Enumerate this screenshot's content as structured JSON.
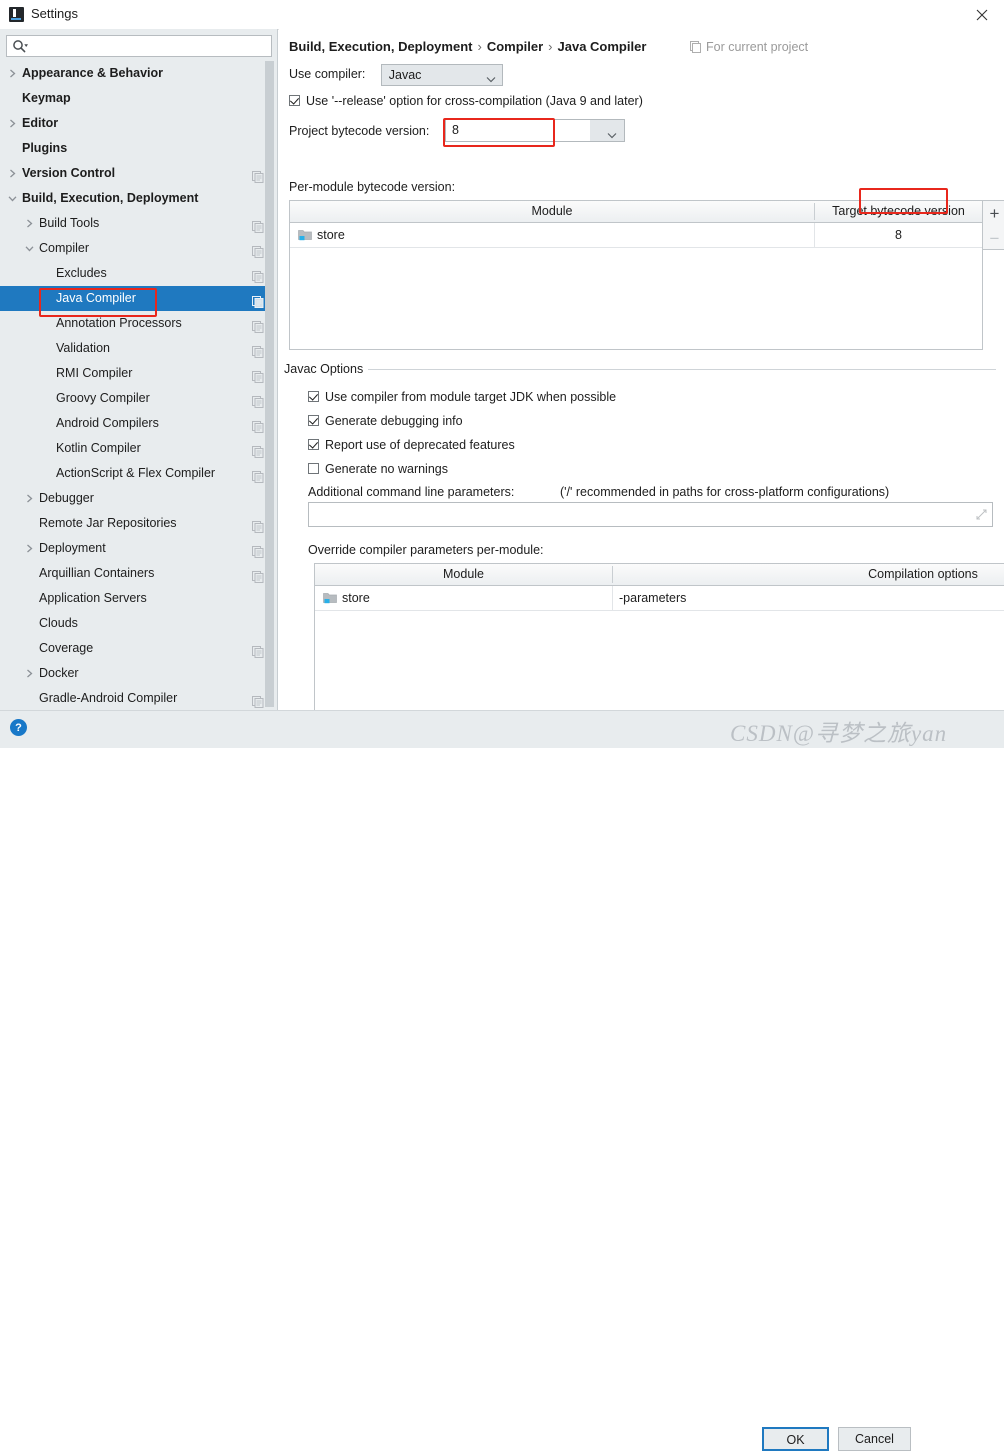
{
  "window": {
    "title": "Settings",
    "app_icon": "intellij-idea-icon",
    "close_label": "✕"
  },
  "sidebar": {
    "search": {
      "placeholder": "",
      "value": "",
      "icon": "search-icon"
    },
    "items": [
      {
        "label": "Appearance & Behavior",
        "indent": 0,
        "arrow": "right",
        "bold": true,
        "gear": false,
        "selected": false
      },
      {
        "label": "Keymap",
        "indent": 0,
        "arrow": "none",
        "bold": true,
        "gear": false,
        "selected": false
      },
      {
        "label": "Editor",
        "indent": 0,
        "arrow": "right",
        "bold": true,
        "gear": false,
        "selected": false
      },
      {
        "label": "Plugins",
        "indent": 0,
        "arrow": "none",
        "bold": true,
        "gear": false,
        "selected": false
      },
      {
        "label": "Version Control",
        "indent": 0,
        "arrow": "right",
        "bold": true,
        "gear": true,
        "selected": false
      },
      {
        "label": "Build, Execution, Deployment",
        "indent": 0,
        "arrow": "down",
        "bold": true,
        "gear": false,
        "selected": false
      },
      {
        "label": "Build Tools",
        "indent": 1,
        "arrow": "right",
        "bold": false,
        "gear": true,
        "selected": false
      },
      {
        "label": "Compiler",
        "indent": 1,
        "arrow": "down",
        "bold": false,
        "gear": true,
        "selected": false
      },
      {
        "label": "Excludes",
        "indent": 2,
        "arrow": "none",
        "bold": false,
        "gear": true,
        "selected": false
      },
      {
        "label": "Java Compiler",
        "indent": 2,
        "arrow": "none",
        "bold": false,
        "gear": true,
        "selected": true
      },
      {
        "label": "Annotation Processors",
        "indent": 2,
        "arrow": "none",
        "bold": false,
        "gear": true,
        "selected": false
      },
      {
        "label": "Validation",
        "indent": 2,
        "arrow": "none",
        "bold": false,
        "gear": true,
        "selected": false
      },
      {
        "label": "RMI Compiler",
        "indent": 2,
        "arrow": "none",
        "bold": false,
        "gear": true,
        "selected": false
      },
      {
        "label": "Groovy Compiler",
        "indent": 2,
        "arrow": "none",
        "bold": false,
        "gear": true,
        "selected": false
      },
      {
        "label": "Android Compilers",
        "indent": 2,
        "arrow": "none",
        "bold": false,
        "gear": true,
        "selected": false
      },
      {
        "label": "Kotlin Compiler",
        "indent": 2,
        "arrow": "none",
        "bold": false,
        "gear": true,
        "selected": false
      },
      {
        "label": "ActionScript & Flex Compiler",
        "indent": 2,
        "arrow": "none",
        "bold": false,
        "gear": true,
        "selected": false
      },
      {
        "label": "Debugger",
        "indent": 1,
        "arrow": "right",
        "bold": false,
        "gear": false,
        "selected": false
      },
      {
        "label": "Remote Jar Repositories",
        "indent": 1,
        "arrow": "none",
        "bold": false,
        "gear": true,
        "selected": false
      },
      {
        "label": "Deployment",
        "indent": 1,
        "arrow": "right",
        "bold": false,
        "gear": true,
        "selected": false
      },
      {
        "label": "Arquillian Containers",
        "indent": 1,
        "arrow": "none",
        "bold": false,
        "gear": true,
        "selected": false
      },
      {
        "label": "Application Servers",
        "indent": 1,
        "arrow": "none",
        "bold": false,
        "gear": false,
        "selected": false
      },
      {
        "label": "Clouds",
        "indent": 1,
        "arrow": "none",
        "bold": false,
        "gear": false,
        "selected": false
      },
      {
        "label": "Coverage",
        "indent": 1,
        "arrow": "none",
        "bold": false,
        "gear": true,
        "selected": false
      },
      {
        "label": "Docker",
        "indent": 1,
        "arrow": "right",
        "bold": false,
        "gear": false,
        "selected": false
      },
      {
        "label": "Gradle-Android Compiler",
        "indent": 1,
        "arrow": "none",
        "bold": false,
        "gear": true,
        "selected": false
      }
    ]
  },
  "main": {
    "breadcrumb": {
      "part1": "Build, Execution, Deployment",
      "sep1": "›",
      "part2": "Compiler",
      "sep2": "›",
      "part3": "Java Compiler"
    },
    "for_current_project": "For current project",
    "use_compiler_label": "Use compiler:",
    "use_compiler_value": "Javac",
    "release_option_label": "Use '--release' option for cross-compilation (Java 9 and later)",
    "release_option_checked": true,
    "project_bytecode_label": "Project bytecode version:",
    "project_bytecode_value": "8",
    "per_module_label": "Per-module bytecode version:",
    "per_module_table": {
      "headers": [
        "Module",
        "Target bytecode version"
      ],
      "rows": [
        {
          "module": "store",
          "target": "8"
        }
      ],
      "add_label": "+",
      "remove_label": "−"
    },
    "javac_group_title": "Javac Options",
    "javac_options": [
      {
        "label": "Use compiler from module target JDK when possible",
        "checked": true
      },
      {
        "label": "Generate debugging info",
        "checked": true
      },
      {
        "label": "Report use of deprecated features",
        "checked": true
      },
      {
        "label": "Generate no warnings",
        "checked": false
      }
    ],
    "additional_params_label": "Additional command line parameters:",
    "additional_params_hint": "('/' recommended in paths for cross-platform configurations)",
    "additional_params_value": "",
    "override_label": "Override compiler parameters per-module:",
    "override_table": {
      "headers": [
        "Module",
        "Compilation options"
      ],
      "rows": [
        {
          "module": "store",
          "options": "-parameters"
        }
      ],
      "add_label": "+",
      "remove_label": "−"
    }
  },
  "footer": {
    "help_label": "?",
    "ok_label": "OK",
    "cancel_label": "Cancel"
  },
  "overlay": {
    "watermark": "CSDN@寻梦之旅yan"
  },
  "colors": {
    "selection_blue": "#1f79c0",
    "annotation_red": "#e8271c",
    "sidebar_bg": "#e8ecee",
    "panel_bg": "#ffffff"
  }
}
